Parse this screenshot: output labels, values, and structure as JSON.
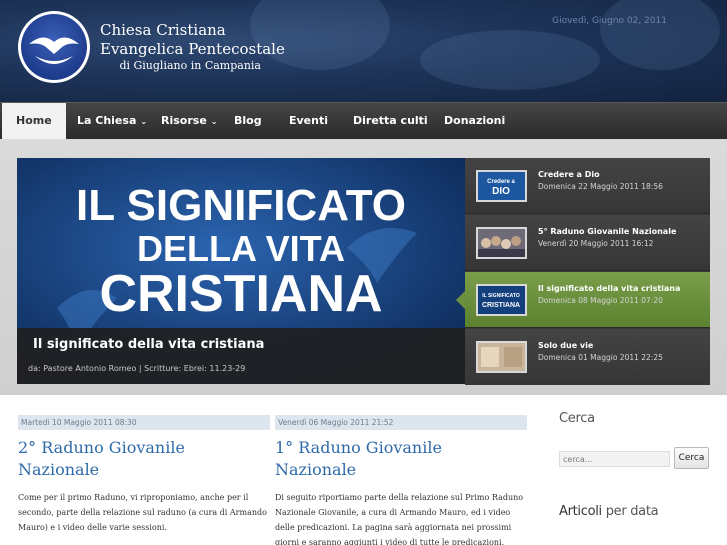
{
  "header": {
    "title_line1": "Chiesa Cristiana",
    "title_line2": "Evangelica Pentecostale",
    "subtitle": "di Giugliano in Campania",
    "date": "Giovedì, Giugno 02, 2011"
  },
  "nav": {
    "items": [
      {
        "label": "Home"
      },
      {
        "label": "La Chiesa"
      },
      {
        "label": "Risorse"
      },
      {
        "label": "Blog"
      },
      {
        "label": "Eventi"
      },
      {
        "label": "Diretta culti"
      },
      {
        "label": "Donazioni"
      }
    ],
    "caret": "⌄"
  },
  "slider": {
    "banner_line1": "IL SIGNIFICATO",
    "banner_line2": "DELLA VITA",
    "banner_line3": "CRISTIANA",
    "caption_title": "Il significato della vita cristiana",
    "caption_meta": "da: Pastore Antonio Romeo | Scritture: Ebrei: 11.23-29",
    "thumbs": [
      {
        "title": "Credere a Dio",
        "date": "Domenica 22 Maggio 2011 18:56",
        "img_line1": "Credere a",
        "img_line2": "DIO"
      },
      {
        "title": "5° Raduno Giovanile Nazionale",
        "date": "Venerdì 20 Maggio 2011 16:12"
      },
      {
        "title": "Il significato della vita cristiana",
        "date": "Domenica 08 Maggio 2011 07:20",
        "img_line1": "IL SIGNIFICATO",
        "img_line2": "CRISTIANA"
      },
      {
        "title": "Solo due vie",
        "date": "Domenica 01 Maggio 2011 22:25"
      }
    ]
  },
  "articles": [
    {
      "date": "Martedì 10 Maggio 2011 08:30",
      "title": "2° Raduno Giovanile Nazionale",
      "body": "Come per il primo Raduno, vi riproponiamo, anche per il secondo, parte della relazione sul raduno (a cura di Armando Mauro) e i video delle varie sessioni."
    },
    {
      "date": "Venerdì 06 Maggio 2011 21:52",
      "title": "1° Raduno Giovanile Nazionale",
      "body": "Di seguito riportiamo parte della relazione sul Primo Raduno Nazionale Giovanile, a cura di Armando Mauro, ed i video delle predicazioni. La pagina sarà aggiornata nei prossimi giorni e saranno aggiunti i video di tutte le predicazioni. Buona visione!"
    }
  ],
  "sidebar": {
    "search_title": "Cerca",
    "search_placeholder": "cerca...",
    "search_button": "Cerca",
    "archive_title_bold": "Articoli",
    "archive_title_rest": " per data"
  },
  "colors": {
    "header_bg": "#1d3358",
    "link_blue": "#2f6aa8",
    "active_thumb": "#6a9040"
  }
}
